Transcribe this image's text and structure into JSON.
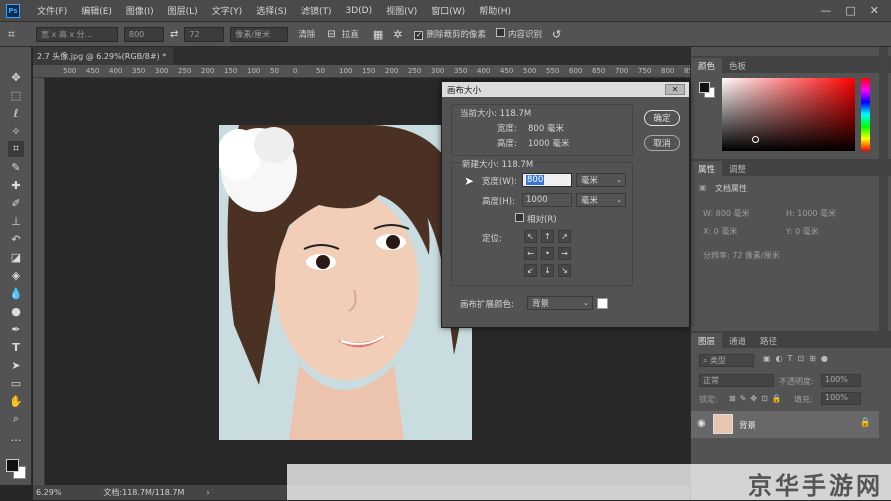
{
  "app": {
    "logo_text": "Ps"
  },
  "menu": [
    "文件(F)",
    "编辑(E)",
    "图像(I)",
    "图层(L)",
    "文字(Y)",
    "选择(S)",
    "滤镜(T)",
    "3D(D)",
    "视图(V)",
    "窗口(W)",
    "帮助(H)"
  ],
  "window_controls": {
    "minimize": "—",
    "maximize": "□",
    "close": "✕"
  },
  "options_bar": {
    "ratio_placeholder": "宽 x 高 x 分...",
    "width_value": "800",
    "height_value": "72",
    "unit": "像素/厘米",
    "clear_label": "清除",
    "straighten_label": "拉直",
    "delete_cropped_label": "删除裁剪的像素",
    "delete_cropped_checked": true,
    "content_aware_label": "内容识别"
  },
  "document": {
    "tab_title": "2.7 头像.jpg @ 6.29%(RGB/8#) *",
    "tab_close": "×",
    "ruler_ticks": [
      "500",
      "450",
      "400",
      "350",
      "300",
      "250",
      "200",
      "150",
      "100",
      "50",
      "0",
      "50",
      "100",
      "150",
      "200",
      "250",
      "300",
      "350",
      "400",
      "450",
      "500",
      "550",
      "600",
      "650",
      "700",
      "750",
      "800",
      "850"
    ]
  },
  "status": {
    "zoom": "6.29%",
    "doc_info": "文档:118.7M/118.7M",
    "arrow": "›"
  },
  "dialog": {
    "title": "画布大小",
    "close_label": "✕",
    "current_size_label": "当前大小: 118.7M",
    "current_width_label": "宽度:",
    "current_width_value": "800 毫米",
    "current_height_label": "高度:",
    "current_height_value": "1000 毫米",
    "new_size_label": "新建大小: 118.7M",
    "width_label": "宽度(W):",
    "width_value": "800",
    "height_label": "高度(H):",
    "height_value": "1000",
    "unit": "毫米",
    "relative_label": "相对(R)",
    "relative_checked": false,
    "anchor_label": "定位:",
    "anchor_glyphs": [
      "↖",
      "↑",
      "↗",
      "←",
      "•",
      "→",
      "↙",
      "↓",
      "↘"
    ],
    "ext_color_label": "画布扩展颜色:",
    "ext_color_value": "背景",
    "ok_label": "确定",
    "cancel_label": "取消"
  },
  "color_panel": {
    "tabs": [
      "颜色",
      "色板"
    ],
    "fg_color": "#111111",
    "bg_color": "#ffffff"
  },
  "properties_panel": {
    "tabs": [
      "属性",
      "调整"
    ],
    "doc_props_label": "文档属性",
    "w_label": "W: 800 毫米",
    "h_label": "H: 1000 毫米",
    "x_label": "X: 0 毫米",
    "y_label": "Y: 0 毫米",
    "resolution_label": "分辨率: 72 像素/厘米"
  },
  "layers_panel": {
    "tabs": [
      "图层",
      "通道",
      "路径"
    ],
    "filter_label": "类型",
    "blend_mode": "正常",
    "opacity_label": "不透明度:",
    "opacity_value": "100%",
    "lock_label": "锁定:",
    "fill_label": "填充:",
    "fill_value": "100%",
    "layer_name": "背景",
    "layer_visible": true
  },
  "watermark": {
    "text": "京华手游网"
  }
}
